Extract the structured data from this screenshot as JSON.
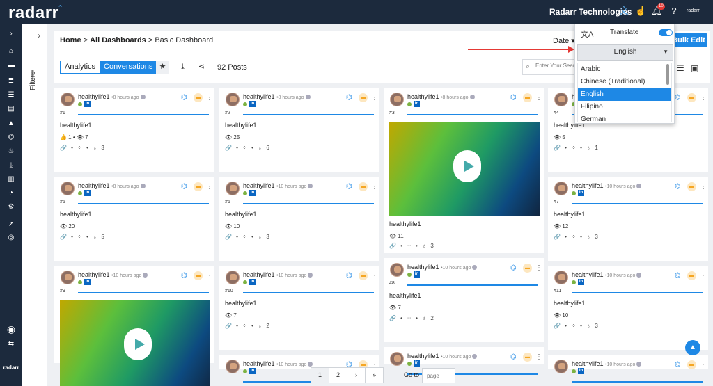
{
  "brand": {
    "logo": "radarr",
    "logo_mark": "ˆ",
    "company": "Radarr Technologies",
    "small_logo": "radarr",
    "sidebar_logo": "radarr"
  },
  "topbar": {
    "notification_count": "10"
  },
  "filters": {
    "label": "Filters",
    "toggle": "›"
  },
  "breadcrumb": {
    "home": "Home",
    "sep": " > ",
    "dashboards": "All Dashboards",
    "current": "Basic Dashboard"
  },
  "toolbar": {
    "date_label": "Date ▾",
    "bulk_edit": "Bulk Edit",
    "tabs": [
      "Analytics",
      "Conversations"
    ],
    "active_tab": "Conversations",
    "posts_count": "92 Posts",
    "search_placeholder": "Enter Your Search"
  },
  "translate": {
    "label": "Translate",
    "enabled": true,
    "selected": "English",
    "options": [
      "Arabic",
      "Chinese (Traditional)",
      "English",
      "Filipino",
      "German"
    ]
  },
  "cards": [
    {
      "user": "healthylife1",
      "time": "8 hours ago",
      "num": "#1",
      "title": "healthylife1",
      "stats": "👍 1 •  👁 7",
      "actions": "🔗 •  ⁘ •  ♁ 3"
    },
    {
      "user": "healthylife1",
      "time": "8 hours ago",
      "num": "#2",
      "title": "healthylife1",
      "stats": "👁 25",
      "actions": "🔗 •  ⁘ •  ♁ 6"
    },
    {
      "user": "healthylife1",
      "time": "8 hours ago",
      "num": "#3",
      "title": "healthylife1",
      "stats": "👁 11",
      "actions": "🔗 •  ⁘ •  ♁ 3"
    },
    {
      "user": "healthylife1",
      "time": "8 hours ago",
      "num": "#4",
      "title": "healthylife1",
      "stats": "👁 5",
      "actions": "🔗 •  ⁘ •  ♁ 1"
    },
    {
      "user": "healthylife1",
      "time": "8 hours ago",
      "num": "#5",
      "title": "healthylife1",
      "stats": "👁 20",
      "actions": "🔗 •  ⁘ •  ♁ 5"
    },
    {
      "user": "healthylife1",
      "time": "10 hours ago",
      "num": "#6",
      "title": "healthylife1",
      "stats": "👁 10",
      "actions": "🔗 •  ⁘ •  ♁ 3"
    },
    {
      "user": "healthylife1",
      "time": "10 hours ago",
      "num": "#7",
      "title": "healthylife1",
      "stats": "👁 12",
      "actions": "🔗 •  ⁘ •  ♁ 3"
    },
    {
      "user": "healthylife1",
      "time": "10 hours ago",
      "num": "#9",
      "title": "",
      "stats": "",
      "actions": ""
    },
    {
      "user": "healthylife1",
      "time": "10 hours ago",
      "num": "#10",
      "title": "healthylife1",
      "stats": "👁 7",
      "actions": "🔗 •  ⁘ •  ♁ 2"
    },
    {
      "user": "healthylife1",
      "time": "10 hours ago",
      "num": "#8",
      "title": "healthylife1",
      "stats": "👁 7",
      "actions": "🔗 •  ⁘ •  ♁ 2"
    },
    {
      "user": "healthylife1",
      "time": "10 hours ago",
      "num": "#11",
      "title": "healthylife1",
      "stats": "👁 10",
      "actions": "🔗 •  ⁘ •  ♁ 3"
    },
    {
      "user": "healthylife1",
      "time": "10 hours ago",
      "num": "",
      "title": "",
      "stats": "",
      "actions": ""
    },
    {
      "user": "healthylife1",
      "time": "10 hours ago",
      "num": "",
      "title": "",
      "stats": "",
      "actions": ""
    },
    {
      "user": "healthylife1",
      "time": "10 hours ago",
      "num": "",
      "title": "",
      "stats": "",
      "actions": ""
    }
  ],
  "pagination": {
    "pages": [
      "1",
      "2",
      "›",
      "»"
    ],
    "goto_label": "Go to",
    "goto_placeholder": "page"
  },
  "colors": {
    "nav": "#1c2a3d",
    "accent": "#1e88e5",
    "arrow": "#e53935"
  }
}
